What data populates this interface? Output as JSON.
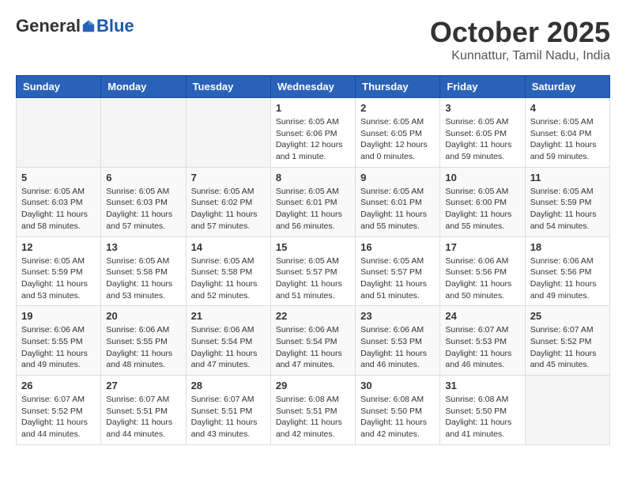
{
  "header": {
    "logo_general": "General",
    "logo_blue": "Blue",
    "month_title": "October 2025",
    "location": "Kunnattur, Tamil Nadu, India"
  },
  "weekdays": [
    "Sunday",
    "Monday",
    "Tuesday",
    "Wednesday",
    "Thursday",
    "Friday",
    "Saturday"
  ],
  "weeks": [
    [
      {
        "day": "",
        "info": ""
      },
      {
        "day": "",
        "info": ""
      },
      {
        "day": "",
        "info": ""
      },
      {
        "day": "1",
        "info": "Sunrise: 6:05 AM\nSunset: 6:06 PM\nDaylight: 12 hours\nand 1 minute."
      },
      {
        "day": "2",
        "info": "Sunrise: 6:05 AM\nSunset: 6:05 PM\nDaylight: 12 hours\nand 0 minutes."
      },
      {
        "day": "3",
        "info": "Sunrise: 6:05 AM\nSunset: 6:05 PM\nDaylight: 11 hours\nand 59 minutes."
      },
      {
        "day": "4",
        "info": "Sunrise: 6:05 AM\nSunset: 6:04 PM\nDaylight: 11 hours\nand 59 minutes."
      }
    ],
    [
      {
        "day": "5",
        "info": "Sunrise: 6:05 AM\nSunset: 6:03 PM\nDaylight: 11 hours\nand 58 minutes."
      },
      {
        "day": "6",
        "info": "Sunrise: 6:05 AM\nSunset: 6:03 PM\nDaylight: 11 hours\nand 57 minutes."
      },
      {
        "day": "7",
        "info": "Sunrise: 6:05 AM\nSunset: 6:02 PM\nDaylight: 11 hours\nand 57 minutes."
      },
      {
        "day": "8",
        "info": "Sunrise: 6:05 AM\nSunset: 6:01 PM\nDaylight: 11 hours\nand 56 minutes."
      },
      {
        "day": "9",
        "info": "Sunrise: 6:05 AM\nSunset: 6:01 PM\nDaylight: 11 hours\nand 55 minutes."
      },
      {
        "day": "10",
        "info": "Sunrise: 6:05 AM\nSunset: 6:00 PM\nDaylight: 11 hours\nand 55 minutes."
      },
      {
        "day": "11",
        "info": "Sunrise: 6:05 AM\nSunset: 5:59 PM\nDaylight: 11 hours\nand 54 minutes."
      }
    ],
    [
      {
        "day": "12",
        "info": "Sunrise: 6:05 AM\nSunset: 5:59 PM\nDaylight: 11 hours\nand 53 minutes."
      },
      {
        "day": "13",
        "info": "Sunrise: 6:05 AM\nSunset: 5:58 PM\nDaylight: 11 hours\nand 53 minutes."
      },
      {
        "day": "14",
        "info": "Sunrise: 6:05 AM\nSunset: 5:58 PM\nDaylight: 11 hours\nand 52 minutes."
      },
      {
        "day": "15",
        "info": "Sunrise: 6:05 AM\nSunset: 5:57 PM\nDaylight: 11 hours\nand 51 minutes."
      },
      {
        "day": "16",
        "info": "Sunrise: 6:05 AM\nSunset: 5:57 PM\nDaylight: 11 hours\nand 51 minutes."
      },
      {
        "day": "17",
        "info": "Sunrise: 6:06 AM\nSunset: 5:56 PM\nDaylight: 11 hours\nand 50 minutes."
      },
      {
        "day": "18",
        "info": "Sunrise: 6:06 AM\nSunset: 5:56 PM\nDaylight: 11 hours\nand 49 minutes."
      }
    ],
    [
      {
        "day": "19",
        "info": "Sunrise: 6:06 AM\nSunset: 5:55 PM\nDaylight: 11 hours\nand 49 minutes."
      },
      {
        "day": "20",
        "info": "Sunrise: 6:06 AM\nSunset: 5:55 PM\nDaylight: 11 hours\nand 48 minutes."
      },
      {
        "day": "21",
        "info": "Sunrise: 6:06 AM\nSunset: 5:54 PM\nDaylight: 11 hours\nand 47 minutes."
      },
      {
        "day": "22",
        "info": "Sunrise: 6:06 AM\nSunset: 5:54 PM\nDaylight: 11 hours\nand 47 minutes."
      },
      {
        "day": "23",
        "info": "Sunrise: 6:06 AM\nSunset: 5:53 PM\nDaylight: 11 hours\nand 46 minutes."
      },
      {
        "day": "24",
        "info": "Sunrise: 6:07 AM\nSunset: 5:53 PM\nDaylight: 11 hours\nand 46 minutes."
      },
      {
        "day": "25",
        "info": "Sunrise: 6:07 AM\nSunset: 5:52 PM\nDaylight: 11 hours\nand 45 minutes."
      }
    ],
    [
      {
        "day": "26",
        "info": "Sunrise: 6:07 AM\nSunset: 5:52 PM\nDaylight: 11 hours\nand 44 minutes."
      },
      {
        "day": "27",
        "info": "Sunrise: 6:07 AM\nSunset: 5:51 PM\nDaylight: 11 hours\nand 44 minutes."
      },
      {
        "day": "28",
        "info": "Sunrise: 6:07 AM\nSunset: 5:51 PM\nDaylight: 11 hours\nand 43 minutes."
      },
      {
        "day": "29",
        "info": "Sunrise: 6:08 AM\nSunset: 5:51 PM\nDaylight: 11 hours\nand 42 minutes."
      },
      {
        "day": "30",
        "info": "Sunrise: 6:08 AM\nSunset: 5:50 PM\nDaylight: 11 hours\nand 42 minutes."
      },
      {
        "day": "31",
        "info": "Sunrise: 6:08 AM\nSunset: 5:50 PM\nDaylight: 11 hours\nand 41 minutes."
      },
      {
        "day": "",
        "info": ""
      }
    ]
  ]
}
